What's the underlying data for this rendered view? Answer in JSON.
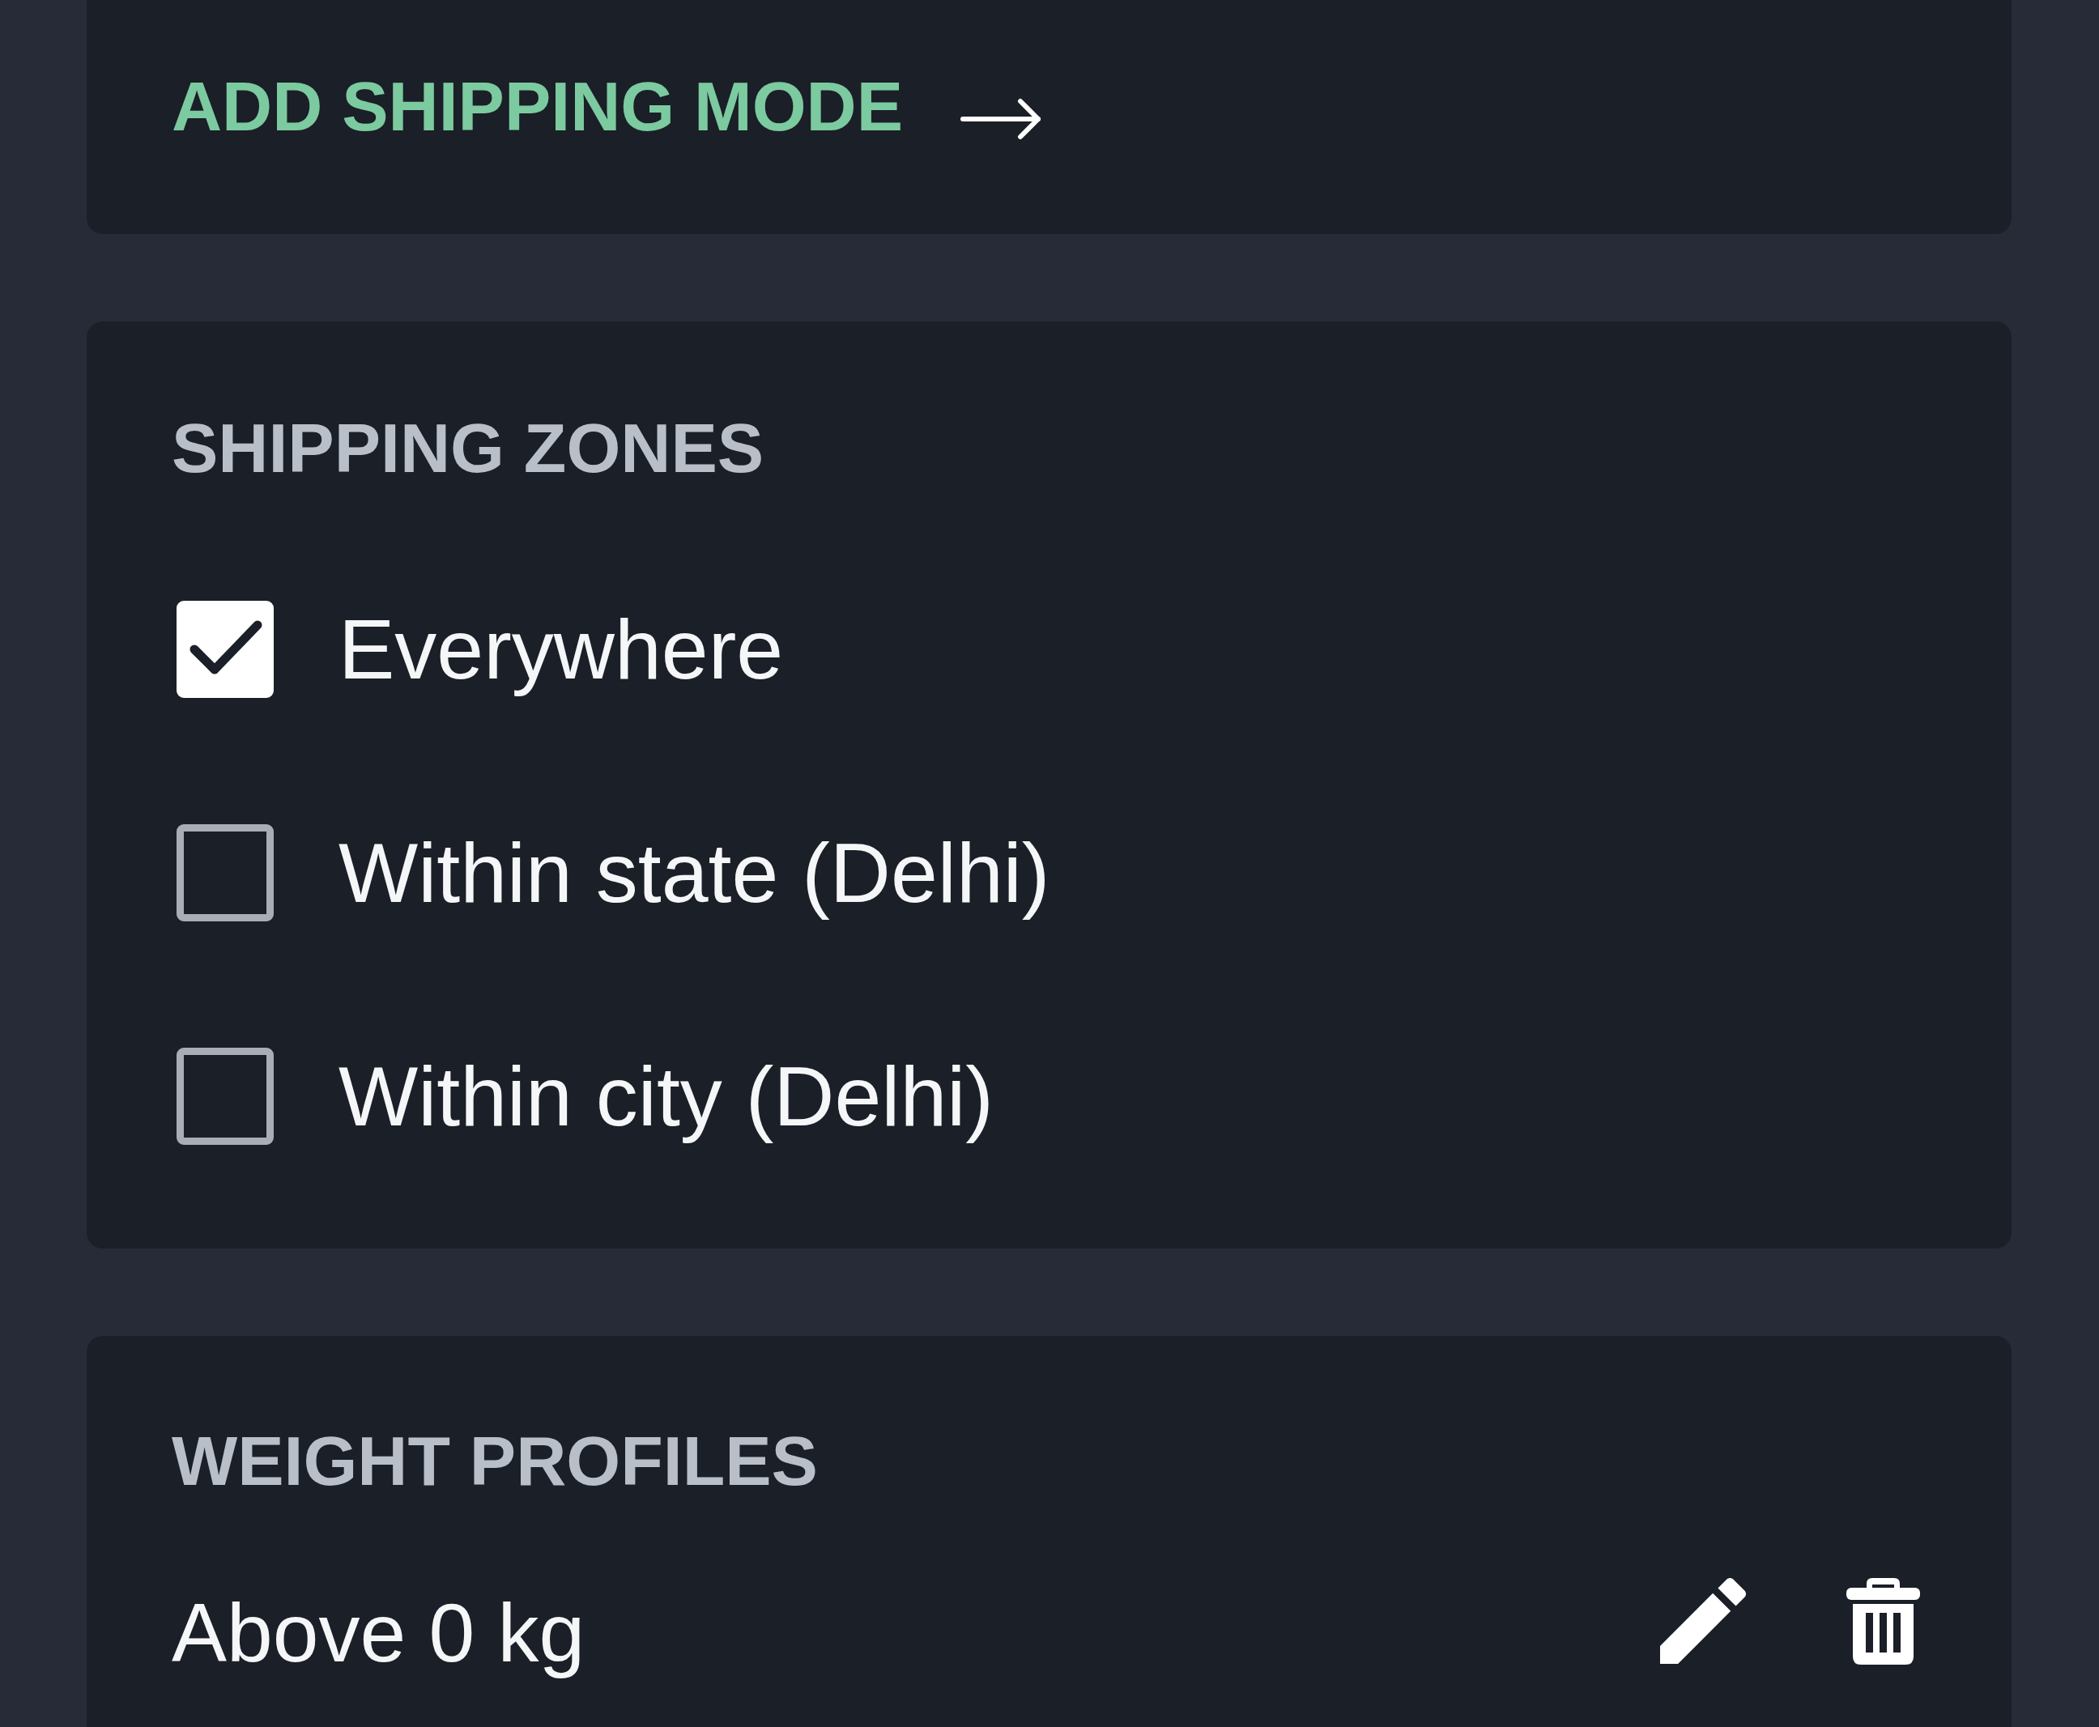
{
  "add_mode_link": {
    "label": "ADD SHIPPING MODE"
  },
  "shipping_zones": {
    "title": "SHIPPING ZONES",
    "options": [
      {
        "label": "Everywhere",
        "checked": true
      },
      {
        "label": "Within state (Delhi)",
        "checked": false
      },
      {
        "label": "Within city (Delhi)",
        "checked": false
      }
    ]
  },
  "weight_profiles": {
    "title": "WEIGHT PROFILES",
    "profiles": [
      {
        "label": "Above 0 kg"
      }
    ]
  }
}
